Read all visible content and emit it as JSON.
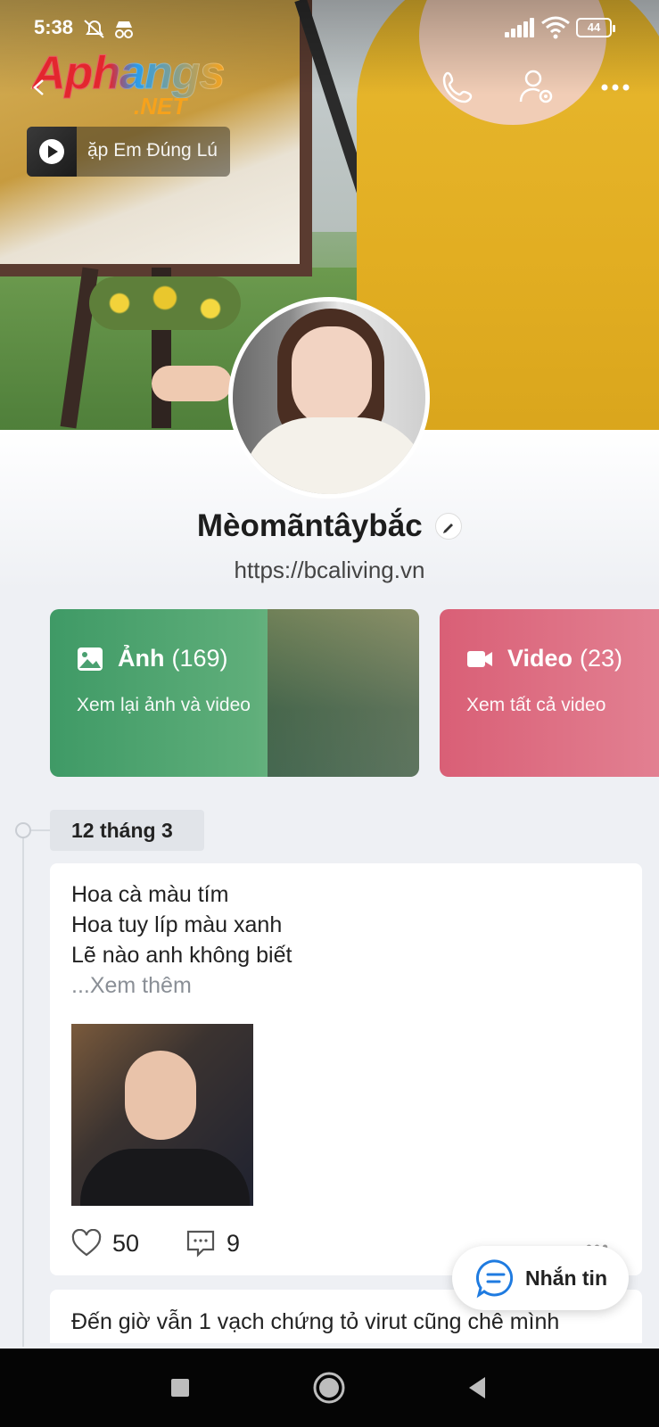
{
  "status_bar": {
    "time": "5:38",
    "battery": "44"
  },
  "header": {
    "logo_main": "Aphangs",
    "logo_sub": ".NET",
    "music_title": "ặp Em Đúng Lú"
  },
  "profile": {
    "name": "Mèomãntâybắc",
    "bio": "https://bcaliving.vn"
  },
  "cards": {
    "photos": {
      "label": "Ảnh",
      "count": "(169)",
      "subtitle": "Xem lại ảnh và video"
    },
    "videos": {
      "label": "Video",
      "count": "(23)",
      "subtitle": "Xem tất cả video"
    }
  },
  "timeline": {
    "date": "12 tháng 3"
  },
  "post": {
    "line1": "Hoa cà màu tím",
    "line2": "Hoa tuy líp màu xanh",
    "line3": "Lẽ nào anh không biết",
    "more": "...Xem thêm",
    "likes": "50",
    "comments": "9",
    "more_dots": "•••"
  },
  "post2": {
    "text": "Đến giờ vẫn 1 vạch chứng tỏ virut cũng chê mình"
  },
  "message_button": {
    "label": "Nhắn tin"
  },
  "colors": {
    "photos_card": "#3f9a66",
    "videos_card": "#d95f76",
    "page_bg": "#eef0f4"
  }
}
